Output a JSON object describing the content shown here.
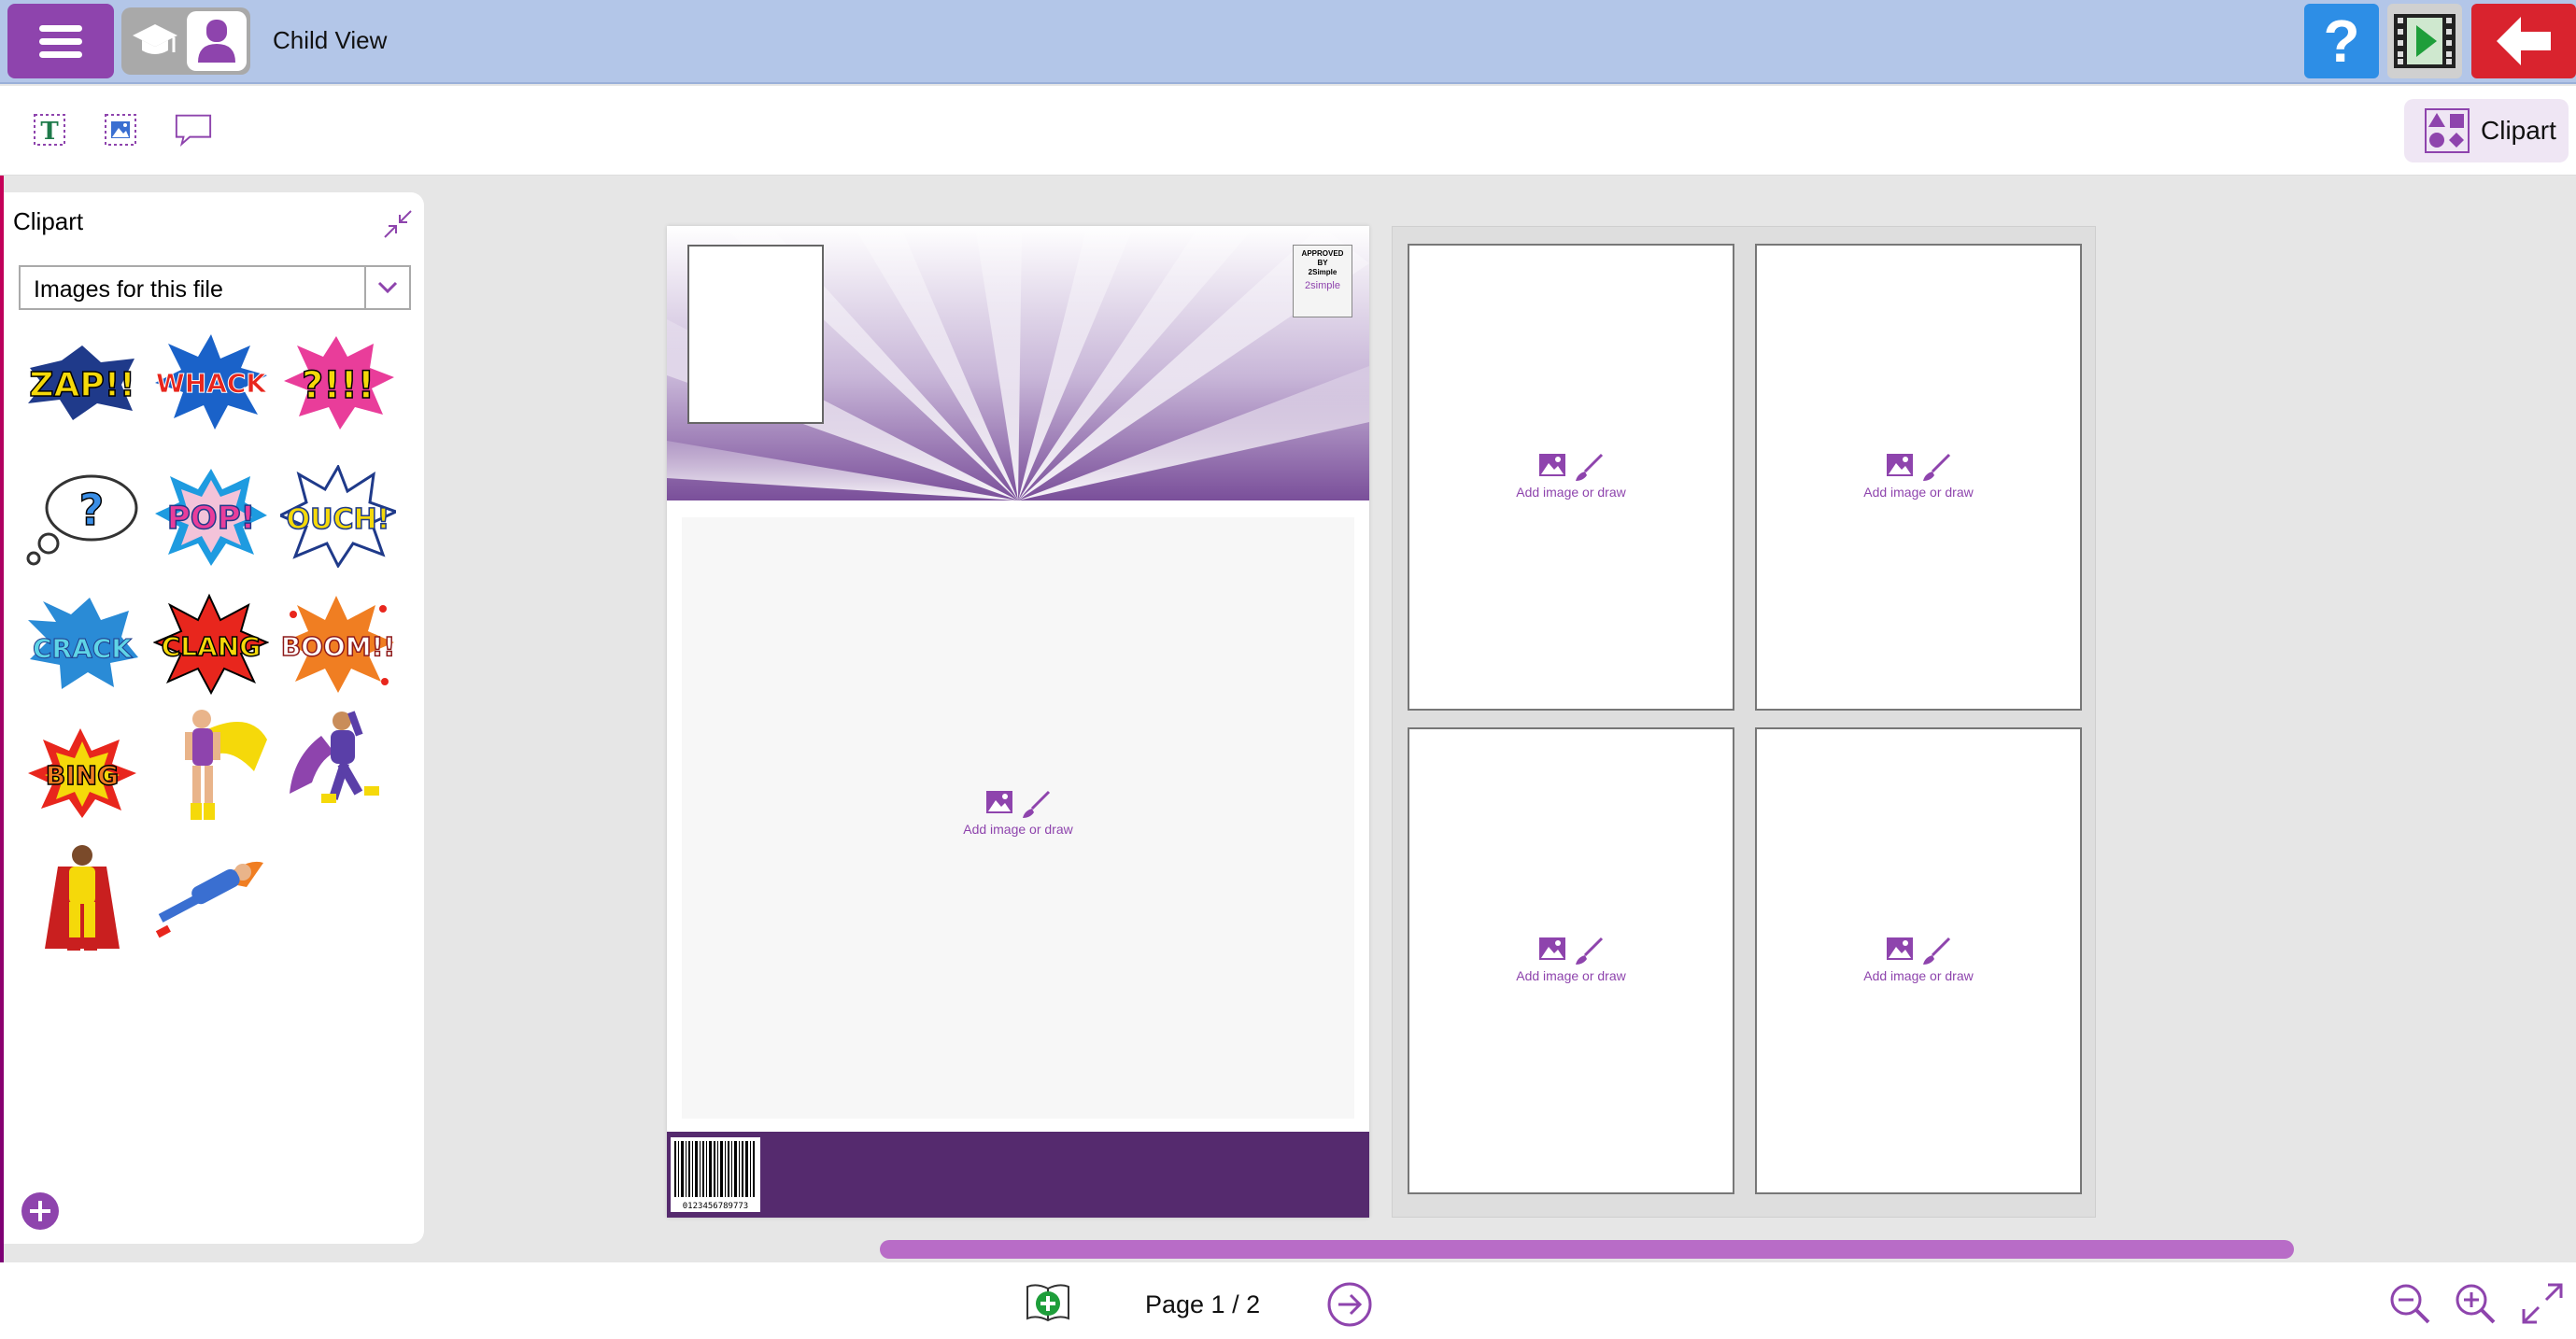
{
  "topbar": {
    "title": "Child View",
    "help_glyph": "?",
    "colors": {
      "bar": "#b3c6e8",
      "menu": "#8e44ad",
      "help": "#2d8ee6",
      "back": "#d9232e"
    }
  },
  "toolbar": {
    "tools": [
      "text-box-icon",
      "image-box-icon",
      "speech-bubble-icon"
    ],
    "clipart_label": "Clipart"
  },
  "clipart": {
    "title": "Clipart",
    "selected_source": "Images for this file",
    "items": [
      {
        "name": "clip-zap",
        "text": "ZAP!!"
      },
      {
        "name": "clip-whack",
        "text": "WHACK"
      },
      {
        "name": "clip-question-exclaim",
        "text": "?!!!"
      },
      {
        "name": "clip-thought-bubble",
        "text": "?"
      },
      {
        "name": "clip-pop",
        "text": "POP!"
      },
      {
        "name": "clip-ouch",
        "text": "OUCH!"
      },
      {
        "name": "clip-crack",
        "text": "CRACK"
      },
      {
        "name": "clip-clang",
        "text": "CLANG"
      },
      {
        "name": "clip-boom",
        "text": "BOOM!!"
      },
      {
        "name": "clip-bing",
        "text": "BING"
      },
      {
        "name": "clip-hero-yellow-cape",
        "text": ""
      },
      {
        "name": "clip-hero-purple",
        "text": ""
      },
      {
        "name": "clip-hero-red-cape",
        "text": ""
      },
      {
        "name": "clip-hero-flying",
        "text": ""
      }
    ]
  },
  "canvas": {
    "approved_line1": "APPROVED",
    "approved_line2": "BY",
    "approved_line3": "2Simple",
    "approved_brand": "2simple",
    "barcode_number": "0123456789773",
    "drop_hint": "Add image or draw",
    "footer_color": "#552a6e"
  },
  "bottom": {
    "page_indicator": "Page 1 / 2"
  }
}
